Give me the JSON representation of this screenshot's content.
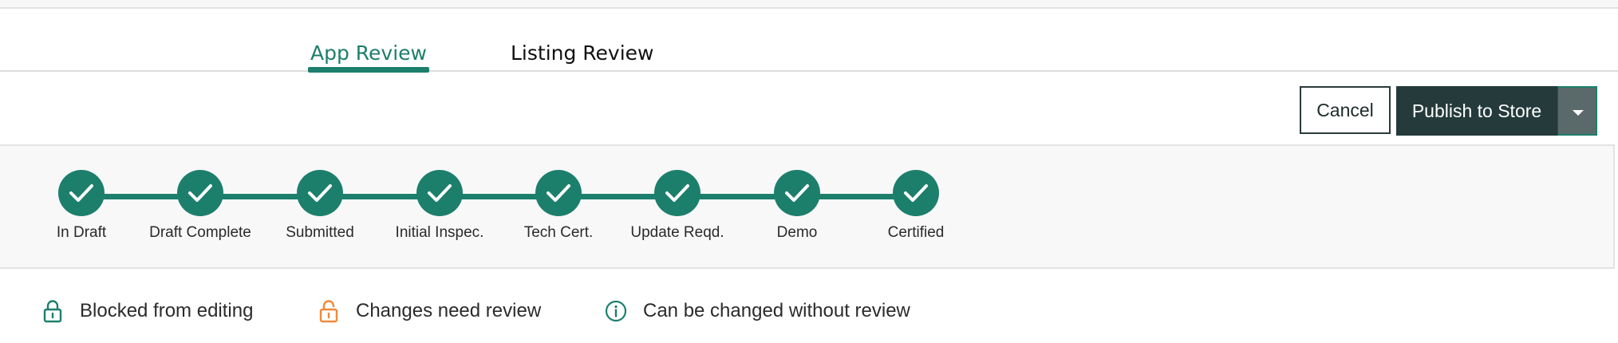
{
  "tabs": [
    {
      "label": "App Review",
      "active": true
    },
    {
      "label": "Listing Review",
      "active": false
    }
  ],
  "actions": {
    "cancel_label": "Cancel",
    "publish_label": "Publish to Store",
    "caret_icon": "chevron-down-icon"
  },
  "progress": {
    "steps": [
      {
        "label": "In Draft",
        "status": "complete"
      },
      {
        "label": "Draft Complete",
        "status": "complete"
      },
      {
        "label": "Submitted",
        "status": "complete"
      },
      {
        "label": "Initial Inspec.",
        "status": "complete"
      },
      {
        "label": "Tech Cert.",
        "status": "complete"
      },
      {
        "label": "Update Reqd.",
        "status": "complete"
      },
      {
        "label": "Demo",
        "status": "complete"
      },
      {
        "label": "Certified",
        "status": "complete"
      }
    ]
  },
  "legend": {
    "items": [
      {
        "label": "Blocked from editing",
        "icon": "lock-closed-icon",
        "color": "#1c7f6c"
      },
      {
        "label": "Changes need review",
        "icon": "lock-open-icon",
        "color": "#f0893a"
      },
      {
        "label": "Can be changed without review",
        "icon": "info-circle-icon",
        "color": "#1c7f6c"
      }
    ]
  },
  "colors": {
    "accent": "#1c7f6c",
    "dark_button": "#243a3b",
    "warning": "#f0893a"
  }
}
